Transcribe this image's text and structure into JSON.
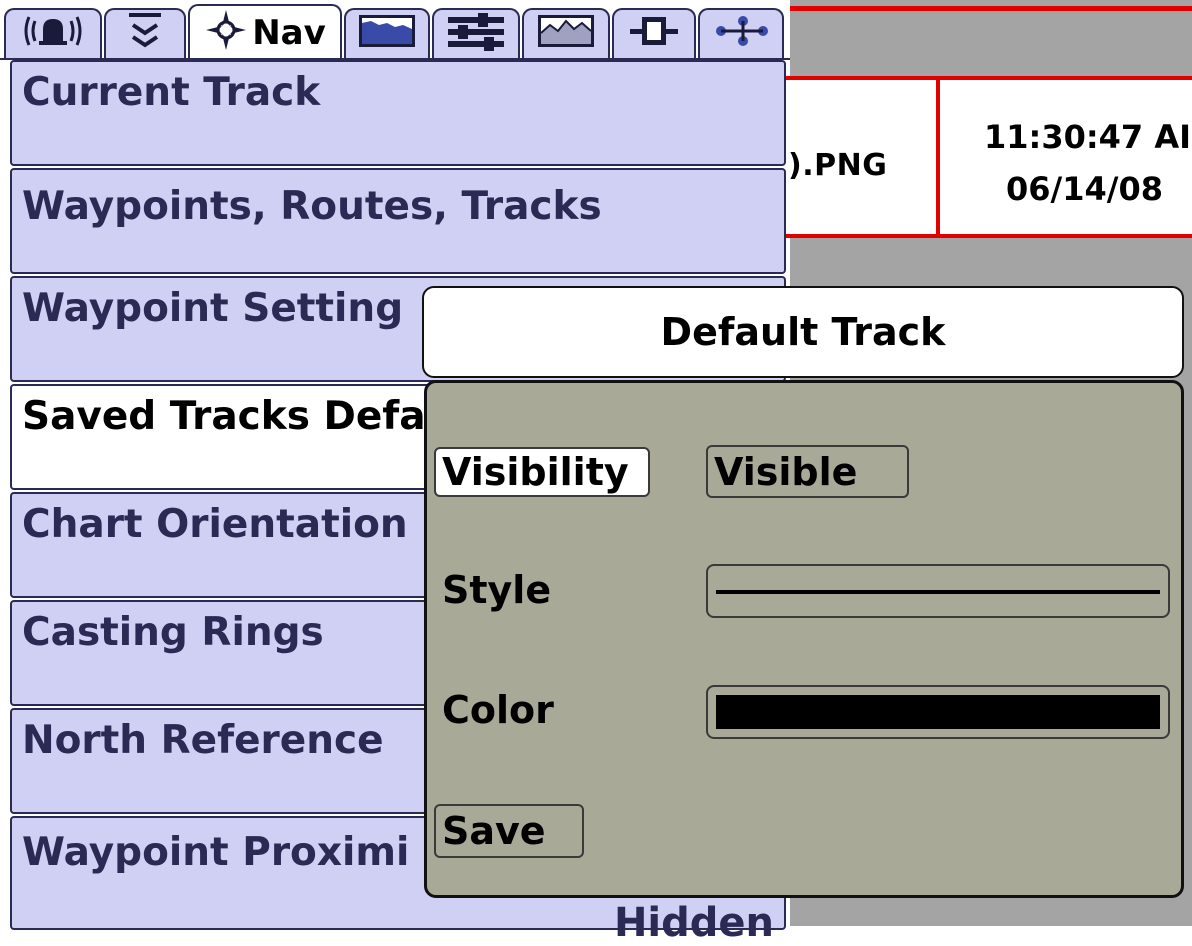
{
  "tabs": [
    {
      "icon": "alarm-icon"
    },
    {
      "icon": "sounder-icon"
    },
    {
      "icon": "nav-icon",
      "label": "Nav"
    },
    {
      "icon": "chart-icon"
    },
    {
      "icon": "setup-icon"
    },
    {
      "icon": "sonar-icon"
    },
    {
      "icon": "accessories-icon"
    },
    {
      "icon": "network-icon"
    }
  ],
  "status": {
    "file": ").PNG",
    "time": "11:30:47 AI",
    "date": "06/14/08"
  },
  "menu": {
    "items": [
      {
        "label": "Current Track"
      },
      {
        "label": "Waypoints, Routes, Tracks"
      },
      {
        "label": "Waypoint Setting"
      },
      {
        "label": "Saved Tracks Defa"
      },
      {
        "label": "Chart Orientation"
      },
      {
        "label": "Casting Rings"
      },
      {
        "label": "North Reference"
      },
      {
        "label": "Waypoint Proximi",
        "value": "Hidden"
      }
    ],
    "selected_index": 3
  },
  "dialog": {
    "title": "Default Track",
    "visibility_label": "Visibility",
    "visibility_value": "Visible",
    "style_label": "Style",
    "color_label": "Color",
    "color_value": "#000000",
    "save_label": "Save"
  },
  "colors": {
    "menu_bg": "#d0d0f4",
    "menu_text": "#2a2a55",
    "dialog_bg": "#a9a998",
    "status_border": "#e00000"
  }
}
